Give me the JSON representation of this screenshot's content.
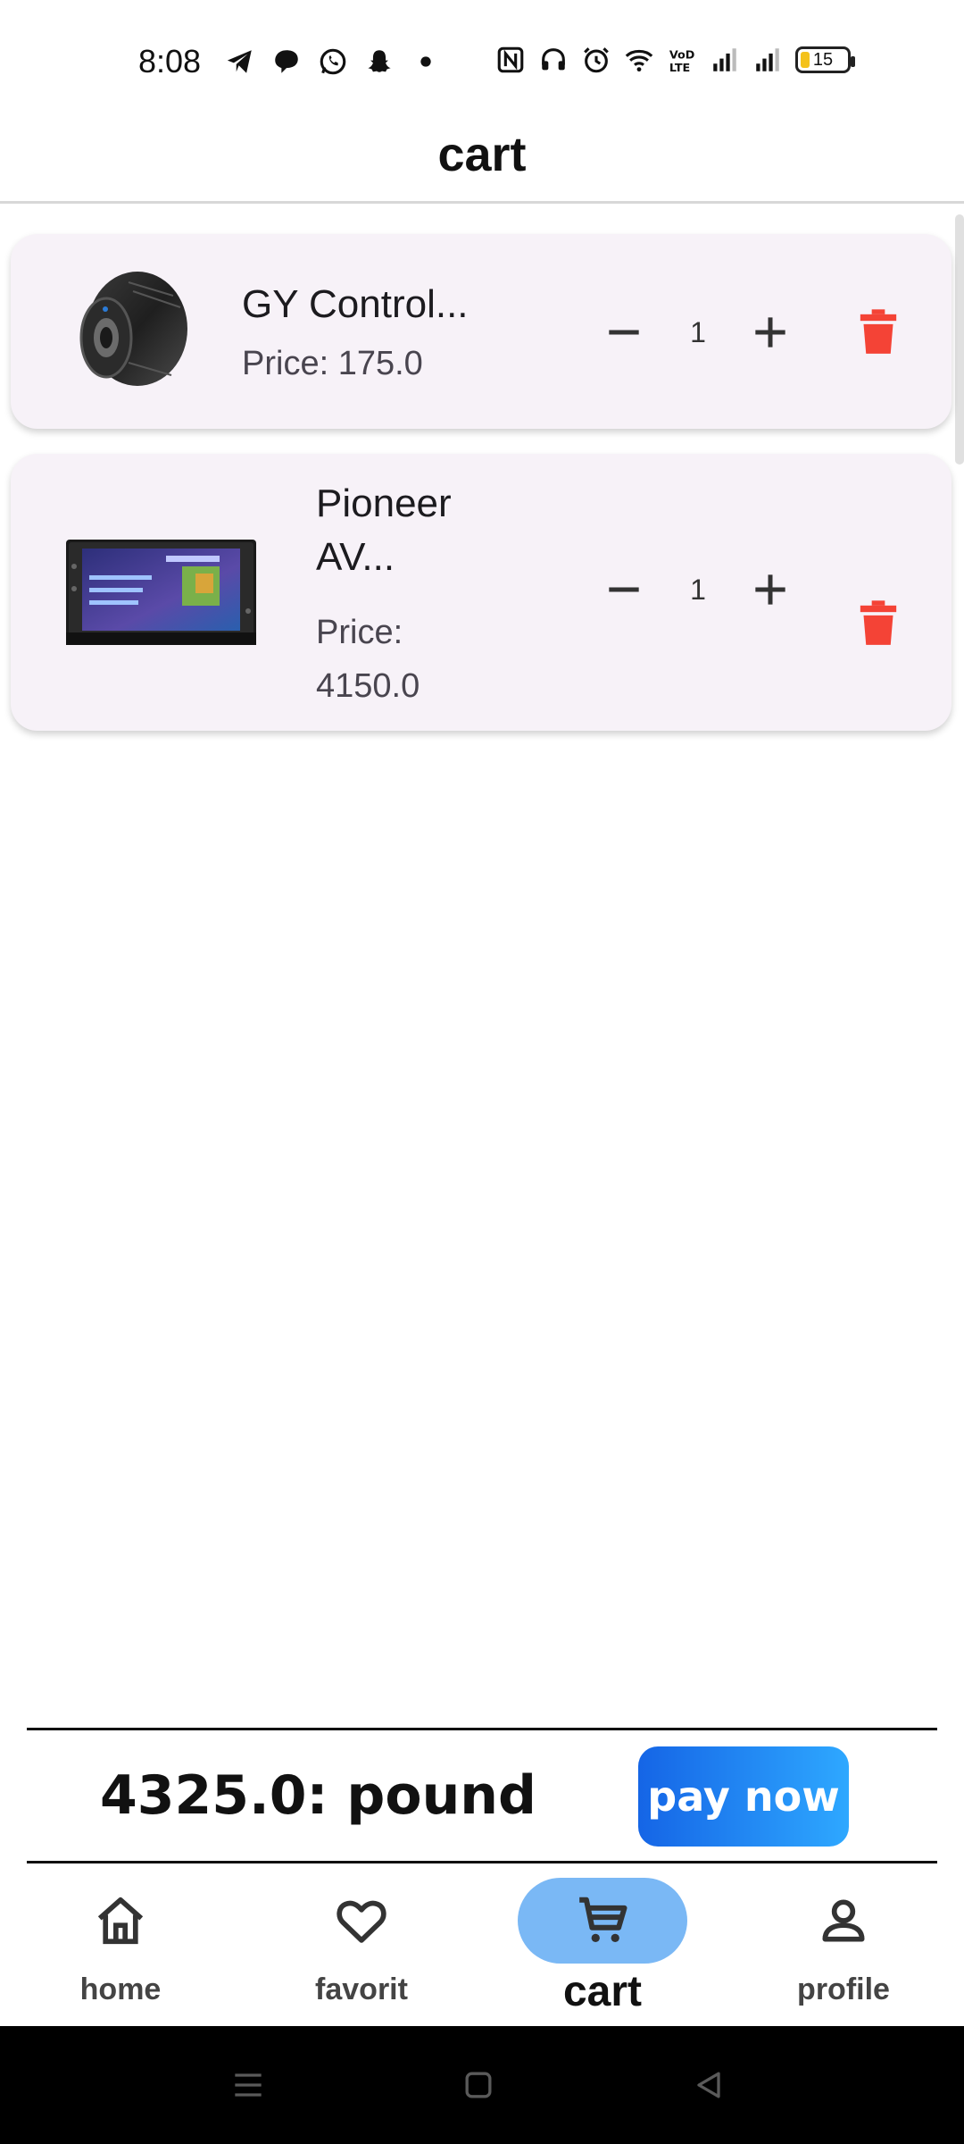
{
  "status_bar": {
    "time": "8:08",
    "battery_level": "15",
    "icons": [
      "telegram-icon",
      "chat-bubble-icon",
      "whatsapp-icon",
      "snapchat-icon",
      "dot-icon",
      "nfc-icon",
      "headphones-icon",
      "alarm-icon",
      "wifi-icon",
      "volte-icon",
      "signal-icon",
      "signal-icon",
      "battery-icon"
    ]
  },
  "app_bar": {
    "title": "cart"
  },
  "cart": {
    "items": [
      {
        "name": "GY Control...",
        "price": "Price: 175.0",
        "quantity": "1",
        "image": "bushing-part-image"
      },
      {
        "name": "Pioneer AV...",
        "price": "Price: 4150.0",
        "quantity": "1",
        "image": "car-stereo-image"
      }
    ]
  },
  "total": {
    "text": "4325.0: pound",
    "pay_label": "pay now"
  },
  "bottom_nav": {
    "items": [
      {
        "label": "home",
        "icon": "home-icon",
        "active": false
      },
      {
        "label": "favorit",
        "icon": "heart-icon",
        "active": false
      },
      {
        "label": "cart",
        "icon": "cart-icon",
        "active": true
      },
      {
        "label": "profile",
        "icon": "person-icon",
        "active": false
      }
    ]
  },
  "system_nav": {
    "icons": [
      "menu-icon",
      "home-square-icon",
      "back-triangle-icon"
    ]
  },
  "colors": {
    "accent": "#7ab8f5",
    "delete": "#f44336",
    "card_bg": "#f7f2f8",
    "pay_button_start": "#1565e6",
    "pay_button_end": "#2ea8ff"
  }
}
